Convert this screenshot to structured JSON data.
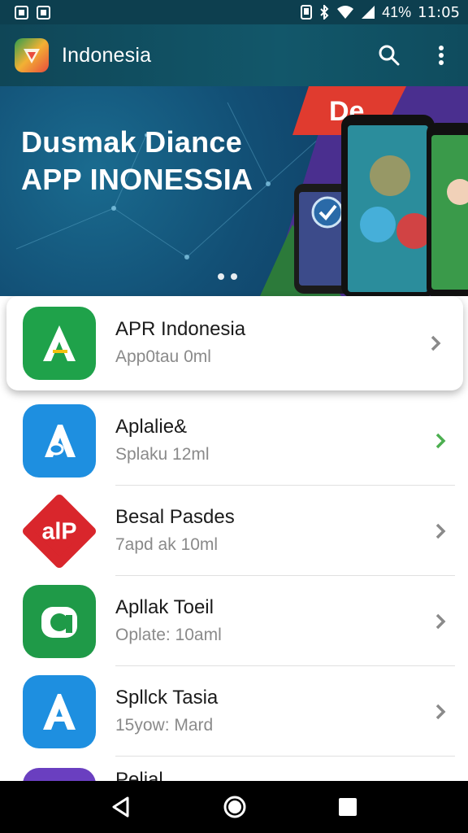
{
  "status_bar": {
    "battery": "41%",
    "time": "11:05"
  },
  "app_bar": {
    "title": "Indonesia",
    "logo_icon": "app-logo-icon",
    "search_icon": "search-icon",
    "menu_icon": "more-vert-icon"
  },
  "banner": {
    "headline_line1": "Dusmak Diance",
    "headline_line2": "APP INONESSIA"
  },
  "list": {
    "items": [
      {
        "name": "APR Indonesia",
        "sub": "App0tau 0ml",
        "icon_color": "#1fa24a"
      },
      {
        "name": "Aplalie&",
        "sub": "Splaku 12ml",
        "icon_color": "#1e8fe0"
      },
      {
        "name": "Besal Pasdes",
        "sub": "7apd ak 10ml",
        "icon_color": "#d9262c"
      },
      {
        "name": "Apllak Toeil",
        "sub": "Oplate: 10aml",
        "icon_color": "#1f9a48"
      },
      {
        "name": "Spllck Tasia",
        "sub": "15yow: Mard",
        "icon_color": "#1e8fe0"
      },
      {
        "name": "Pelial",
        "sub": "",
        "icon_color": "#6a3fc0"
      }
    ]
  },
  "colors": {
    "appbar": "#12576a",
    "accent_green": "#4caf50"
  }
}
